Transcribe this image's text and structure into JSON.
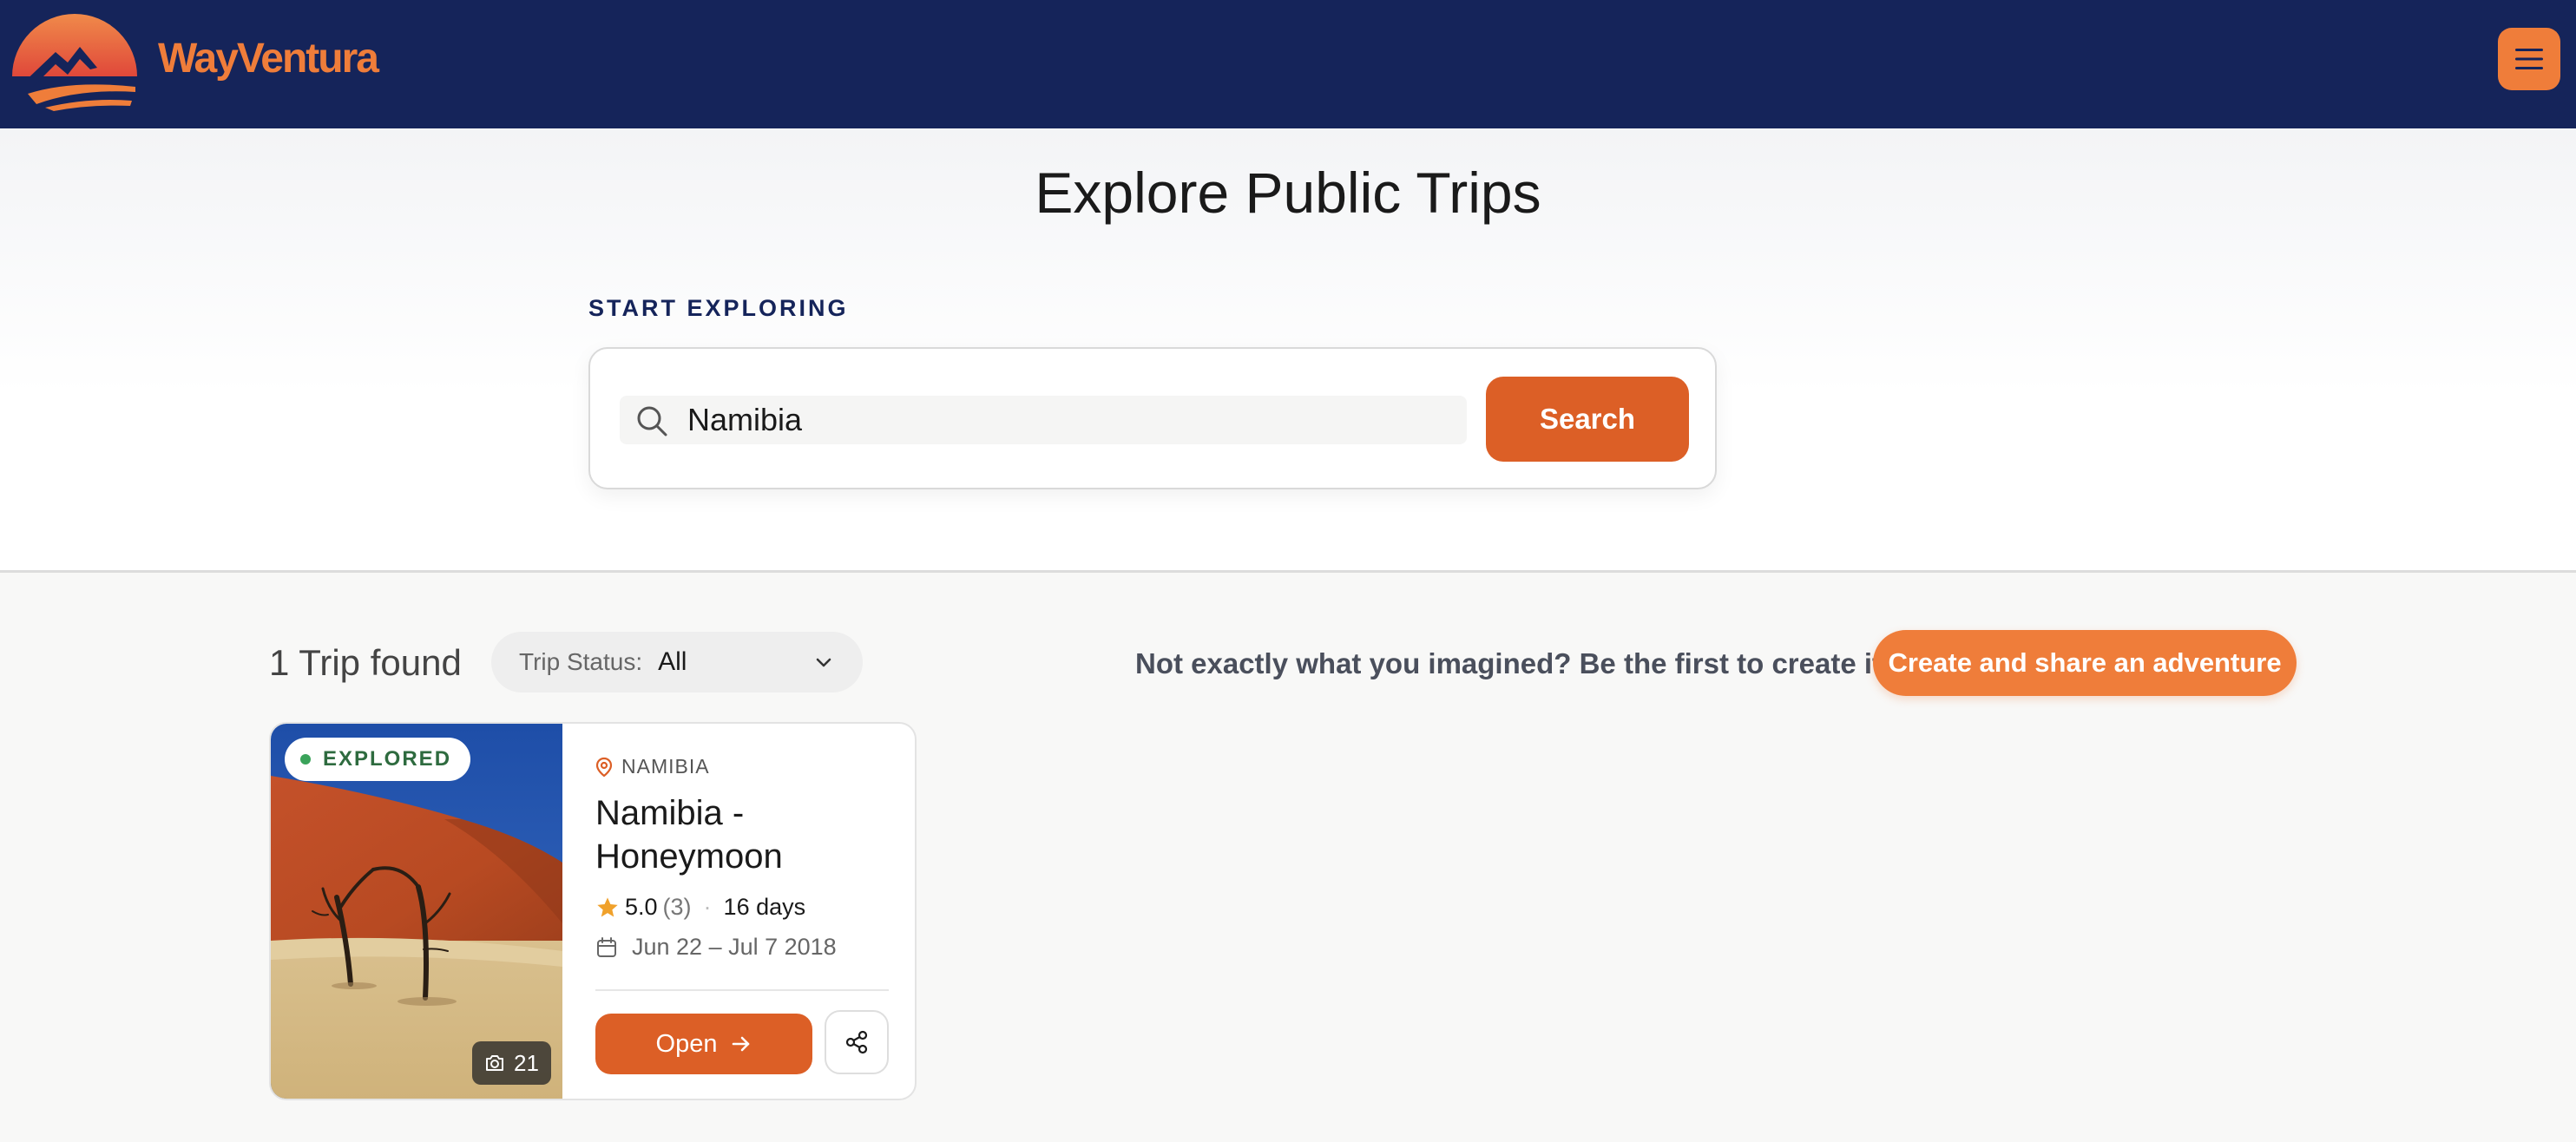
{
  "header": {
    "brand": "WayVentura",
    "logo_icon": "sunset-mountain-logo",
    "menu_icon": "hamburger-menu-icon",
    "colors": {
      "navbar": "#15245a",
      "accent": "#ef7d3a"
    }
  },
  "hero": {
    "title": "Explore Public Trips",
    "section_label": "START EXPLORING",
    "search": {
      "value": "Namibia",
      "placeholder": "",
      "button_label": "Search",
      "icon": "search-icon"
    }
  },
  "results": {
    "count_label": "1 Trip found",
    "status_filter": {
      "label": "Trip Status:",
      "selected": "All"
    },
    "cta_text": "Not exactly what you imagined? Be the first to create it!",
    "cta_button": "Create and share an adventure"
  },
  "trips": [
    {
      "badge": "EXPLORED",
      "photo_count": "21",
      "country": "NAMIBIA",
      "title": "Namibia - Honeymoon",
      "rating": "5.0",
      "rating_count": "(3)",
      "duration": "16 days",
      "dates": "Jun 22 – Jul 7 2018",
      "open_label": "Open",
      "colors": {
        "primary_button": "#dc5f26",
        "star": "#f0a12b",
        "explored": "#3aa35a"
      }
    }
  ]
}
